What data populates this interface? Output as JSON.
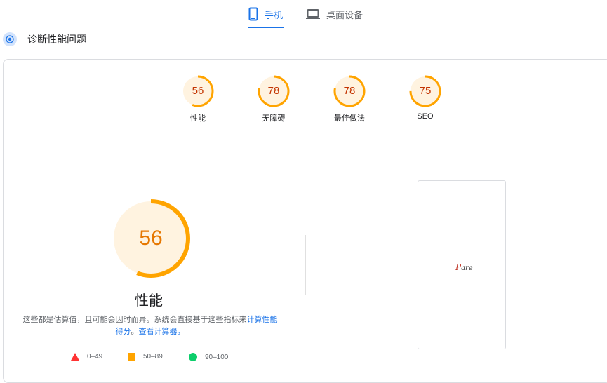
{
  "tabs": {
    "mobile": {
      "label": "手机"
    },
    "desktop": {
      "label": "桌面设备"
    }
  },
  "diagnose": {
    "label": "诊断性能问题"
  },
  "scores": [
    {
      "value": "56",
      "label": "性能",
      "fraction": 0.56
    },
    {
      "value": "78",
      "label": "无障碍",
      "fraction": 0.78
    },
    {
      "value": "78",
      "label": "最佳做法",
      "fraction": 0.78
    },
    {
      "value": "75",
      "label": "SEO",
      "fraction": 0.75
    }
  ],
  "performance": {
    "score": "56",
    "fraction": 0.56,
    "title": "性能",
    "desc_text": "这些都是估算值，且可能会因时而异。系统会直接基于这些指标来",
    "link1": "计算性能得分",
    "sep": "。",
    "link2": "查看计算器。"
  },
  "legend": {
    "fail": "0–49",
    "average": "50–89",
    "pass": "90–100"
  },
  "preview": {
    "logo_initial": "P",
    "logo_rest": "are"
  },
  "colors": {
    "accent": "#1a73e8",
    "average_stroke": "#ffa400",
    "average_fill": "#fff3e0",
    "average_text": "#c33300",
    "fail": "#ff3333",
    "pass": "#0cce6b"
  }
}
